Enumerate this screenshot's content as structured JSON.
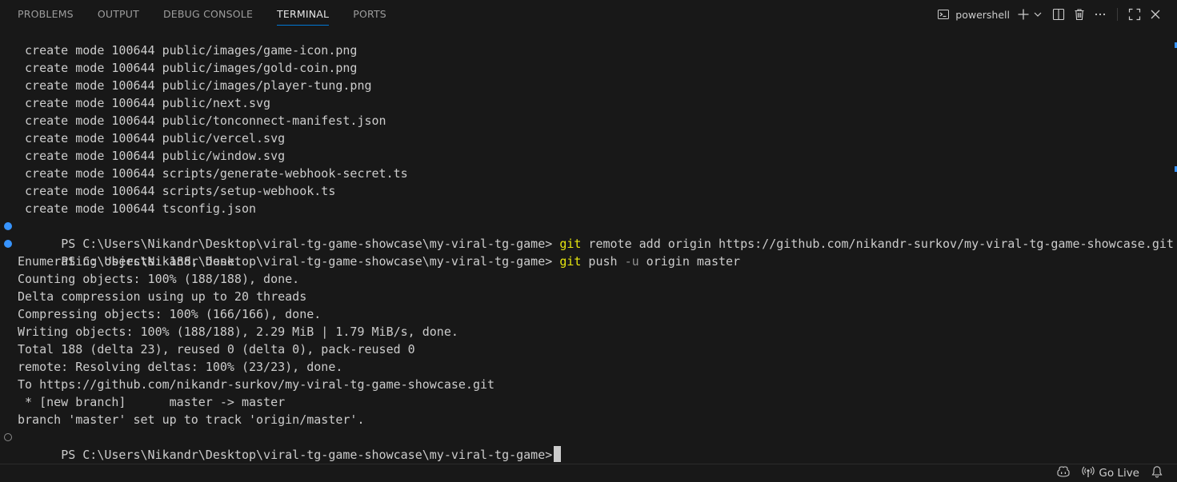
{
  "tabs": [
    {
      "label": "PROBLEMS"
    },
    {
      "label": "OUTPUT"
    },
    {
      "label": "DEBUG CONSOLE"
    },
    {
      "label": "TERMINAL",
      "active": true
    },
    {
      "label": "PORTS"
    }
  ],
  "toolbar": {
    "terminal_name": "powershell",
    "icons": [
      "terminal-icon",
      "plus-icon",
      "chevron-down-icon",
      "split-icon",
      "trash-icon",
      "more-icon",
      "maximize-icon",
      "close-icon"
    ]
  },
  "terminal": {
    "output_top": [
      " create mode 100644 public/images/game-icon.png",
      " create mode 100644 public/images/gold-coin.png",
      " create mode 100644 public/images/player-tung.png",
      " create mode 100644 public/next.svg",
      " create mode 100644 public/tonconnect-manifest.json",
      " create mode 100644 public/vercel.svg",
      " create mode 100644 public/window.svg",
      " create mode 100644 scripts/generate-webhook-secret.ts",
      " create mode 100644 scripts/setup-webhook.ts",
      " create mode 100644 tsconfig.json"
    ],
    "prompt": "PS C:\\Users\\Nikandr\\Desktop\\viral-tg-game-showcase\\my-viral-tg-game> ",
    "cmd1": {
      "git": "git",
      "rest": " remote add origin https://github.com/nikandr-surkov/my-viral-tg-game-showcase.git"
    },
    "cmd2": {
      "git": "git",
      "mid": " push ",
      "flag": "-u",
      "rest": " origin master"
    },
    "output_bottom": [
      "Enumerating objects: 188, done.",
      "Counting objects: 100% (188/188), done.",
      "Delta compression using up to 20 threads",
      "Compressing objects: 100% (166/166), done.",
      "Writing objects: 100% (188/188), 2.29 MiB | 1.79 MiB/s, done.",
      "Total 188 (delta 23), reused 0 (delta 0), pack-reused 0",
      "remote: Resolving deltas: 100% (23/23), done.",
      "To https://github.com/nikandr-surkov/my-viral-tg-game-showcase.git",
      " * [new branch]      master -> master",
      "branch 'master' set up to track 'origin/master'."
    ],
    "final_prompt": "PS C:\\Users\\Nikandr\\Desktop\\viral-tg-game-showcase\\my-viral-tg-game>"
  },
  "statusbar": {
    "golive_label": "Go Live",
    "icons": [
      "copilot-icon",
      "broadcast-icon",
      "bell-icon"
    ]
  },
  "colors": {
    "accent": "#0078d4",
    "command": "#e5e510",
    "decoration_success": "#3794ff"
  }
}
